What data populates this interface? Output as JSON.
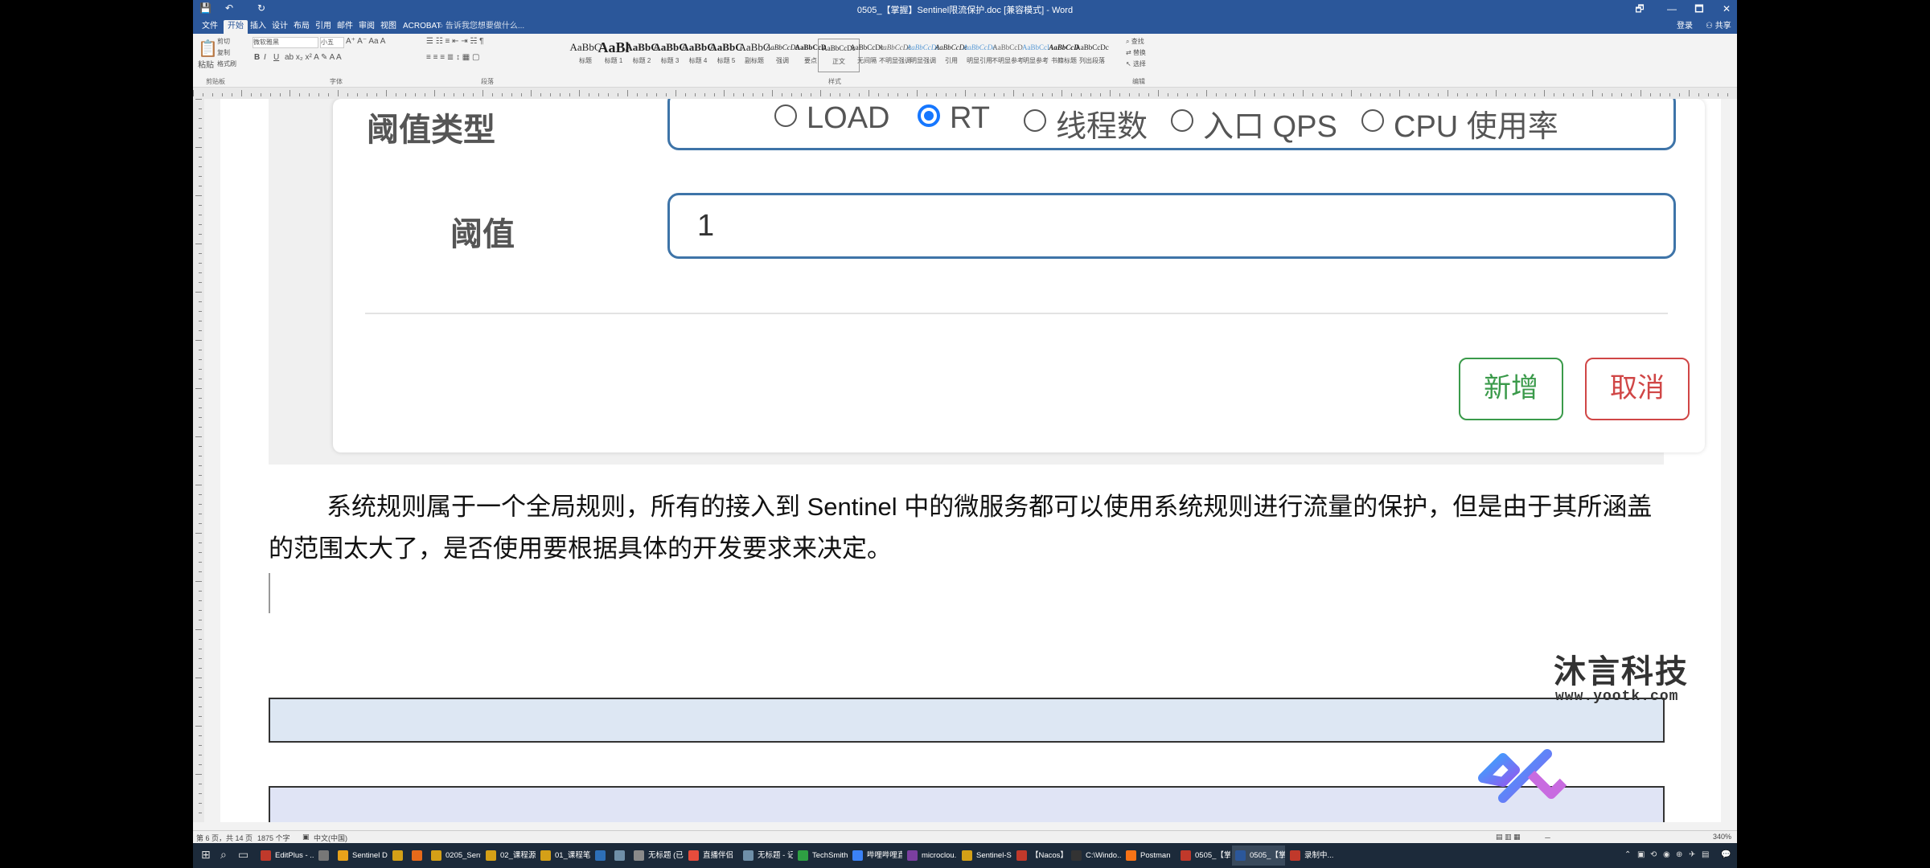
{
  "window": {
    "title": "0505_【掌握】Sentinel限流保护.doc [兼容模式] - Word",
    "quick_access": [
      "💾",
      "↶",
      "↻"
    ],
    "controls": [
      "🗗",
      "—",
      "🗖",
      "✕"
    ],
    "signin": "登录",
    "share": "共享"
  },
  "ribbon_tabs": [
    "文件",
    "开始",
    "插入",
    "设计",
    "布局",
    "引用",
    "邮件",
    "审阅",
    "视图",
    "ACROBAT"
  ],
  "tell_me": "告诉我您想要做什么...",
  "ribbon": {
    "font_name": "微软雅黑",
    "font_size": "小五",
    "paste_label": "粘贴",
    "clipboard_items": [
      "剪切",
      "复制",
      "格式刷"
    ],
    "groups": [
      "剪贴板",
      "字体",
      "段落",
      "样式",
      "编辑"
    ],
    "styles": [
      {
        "preview": "AaBbC",
        "name": "标题"
      },
      {
        "preview": "AaBl",
        "name": "标题 1"
      },
      {
        "preview": "AaBbC",
        "name": "标题 2"
      },
      {
        "preview": "AaBbC",
        "name": "标题 3"
      },
      {
        "preview": "AaBbC",
        "name": "标题 4"
      },
      {
        "preview": "AaBbC",
        "name": "标题 5"
      },
      {
        "preview": "AaBbC",
        "name": "副标题"
      },
      {
        "preview": "AaBbCcDc",
        "name": "强调"
      },
      {
        "preview": "AaBbCcD",
        "name": "要点"
      },
      {
        "preview": "AaBbCcDc",
        "name": "正文"
      },
      {
        "preview": "AaBbCcDc",
        "name": "无间隔"
      },
      {
        "preview": "AaBbCcDc",
        "name": "不明显强调"
      },
      {
        "preview": "AaBbCcDc",
        "name": "明显强调"
      },
      {
        "preview": "AaBbCcDc",
        "name": "引用"
      },
      {
        "preview": "AaBbCcDc",
        "name": "明显引用"
      },
      {
        "preview": "AaBbCcD",
        "name": "不明显参考"
      },
      {
        "preview": "AaBbCcI",
        "name": "明显参考"
      },
      {
        "preview": "AaBbCcD",
        "name": "书籍标题"
      },
      {
        "preview": "AaBbCcDc",
        "name": "列出段落"
      }
    ],
    "editing": [
      "查找",
      "替换",
      "选择"
    ]
  },
  "form": {
    "threshold_type_label": "阈值类型",
    "radios": [
      {
        "label": "LOAD",
        "checked": false
      },
      {
        "label": "RT",
        "checked": true
      },
      {
        "label": "线程数",
        "checked": false
      },
      {
        "label": "入口 QPS",
        "checked": false
      },
      {
        "label": "CPU 使用率",
        "checked": false
      }
    ],
    "threshold_label": "阈值",
    "threshold_value": "1",
    "add_button": "新增",
    "cancel_button": "取消"
  },
  "paragraph": "系统规则属于一个全局规则，所有的接入到 Sentinel 中的微服务都可以使用系统规则进行流量的保护，但是由于其所涵盖的范围太大了，是否使用要根据具体的开发要求来决定。",
  "watermark": {
    "name": "沐言科技",
    "url": "www.yootk.com"
  },
  "status": {
    "page": "第 6 页，共 14 页",
    "words": "1875 个字",
    "language": "中文(中国)",
    "zoom": "340%"
  },
  "taskbar": [
    {
      "label": "EditPlus - ...",
      "color": "#c0392b"
    },
    {
      "label": "",
      "color": "#777777"
    },
    {
      "label": "Sentinel D...",
      "color": "#e8a21a"
    },
    {
      "label": "",
      "color": "#d4a017"
    },
    {
      "label": "",
      "color": "#e86a1a"
    },
    {
      "label": "0205_Sent...",
      "color": "#d4a017"
    },
    {
      "label": "02_课程源...",
      "color": "#d4a017"
    },
    {
      "label": "01_课程笔记",
      "color": "#d4a017"
    },
    {
      "label": "",
      "color": "#2d6fb7"
    },
    {
      "label": "",
      "color": "#6f8fa8"
    },
    {
      "label": "无标题 (已...",
      "color": "#8a8a8a"
    },
    {
      "label": "直播伴侣",
      "color": "#e74c3c"
    },
    {
      "label": "无标题 - 记...",
      "color": "#6f8fa8"
    },
    {
      "label": "TechSmith...",
      "color": "#2ea043"
    },
    {
      "label": "哔哩哔哩直...",
      "color": "#3b82f6"
    },
    {
      "label": "microclou...",
      "color": "#7b3fa0"
    },
    {
      "label": "Sentinel-S...",
      "color": "#d4a017"
    },
    {
      "label": "【Nacos】...",
      "color": "#c0392b"
    },
    {
      "label": "C:\\Windo...",
      "color": "#333333"
    },
    {
      "label": "Postman",
      "color": "#f97316"
    },
    {
      "label": "0505_【掌...",
      "color": "#c0392b"
    },
    {
      "label": "0505_【掌...",
      "color": "#2b579a"
    },
    {
      "label": "录制中...",
      "color": "#c0392b"
    }
  ],
  "start_icons": [
    "⊞",
    "⌕",
    "▭"
  ],
  "tray_icons": [
    "⌃",
    "▣",
    "⟲",
    "◉",
    "⊕",
    "✈",
    "▤",
    "💬"
  ]
}
